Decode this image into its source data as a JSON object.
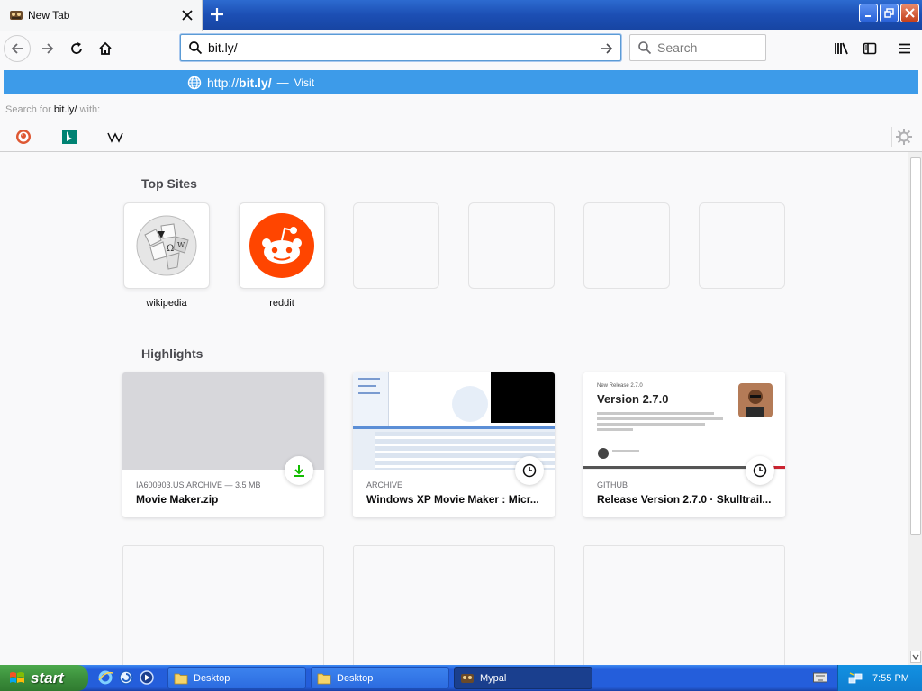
{
  "tab": {
    "title": "New Tab"
  },
  "urlbar": {
    "value": "bit.ly/"
  },
  "searchbar": {
    "placeholder": "Search"
  },
  "autocomplete": {
    "url_prefix": "http://",
    "url_bold": "bit.ly/",
    "separator": "—",
    "action": "Visit",
    "search_for_prefix": "Search for",
    "search_for_term": "bit.ly/",
    "search_for_suffix": "with:"
  },
  "top_sites": {
    "title": "Top Sites",
    "items": [
      {
        "label": "wikipedia"
      },
      {
        "label": "reddit"
      }
    ]
  },
  "highlights": {
    "title": "Highlights",
    "cards": [
      {
        "meta": "IA600903.US.ARCHIVE — 3.5 MB",
        "title": "Movie Maker.zip"
      },
      {
        "meta": "ARCHIVE",
        "title": "Windows XP Movie Maker : Micr..."
      },
      {
        "meta": "GITHUB",
        "title": "Release Version 2.7.0 · Skulltrail...",
        "thumb_small": "New Release 2.7.0",
        "thumb_title": "Version 2.7.0"
      }
    ]
  },
  "taskbar": {
    "start_label": "start",
    "tasks": [
      {
        "label": "Desktop"
      },
      {
        "label": "Desktop"
      },
      {
        "label": "Mypal"
      }
    ],
    "clock": "7:55 PM"
  }
}
